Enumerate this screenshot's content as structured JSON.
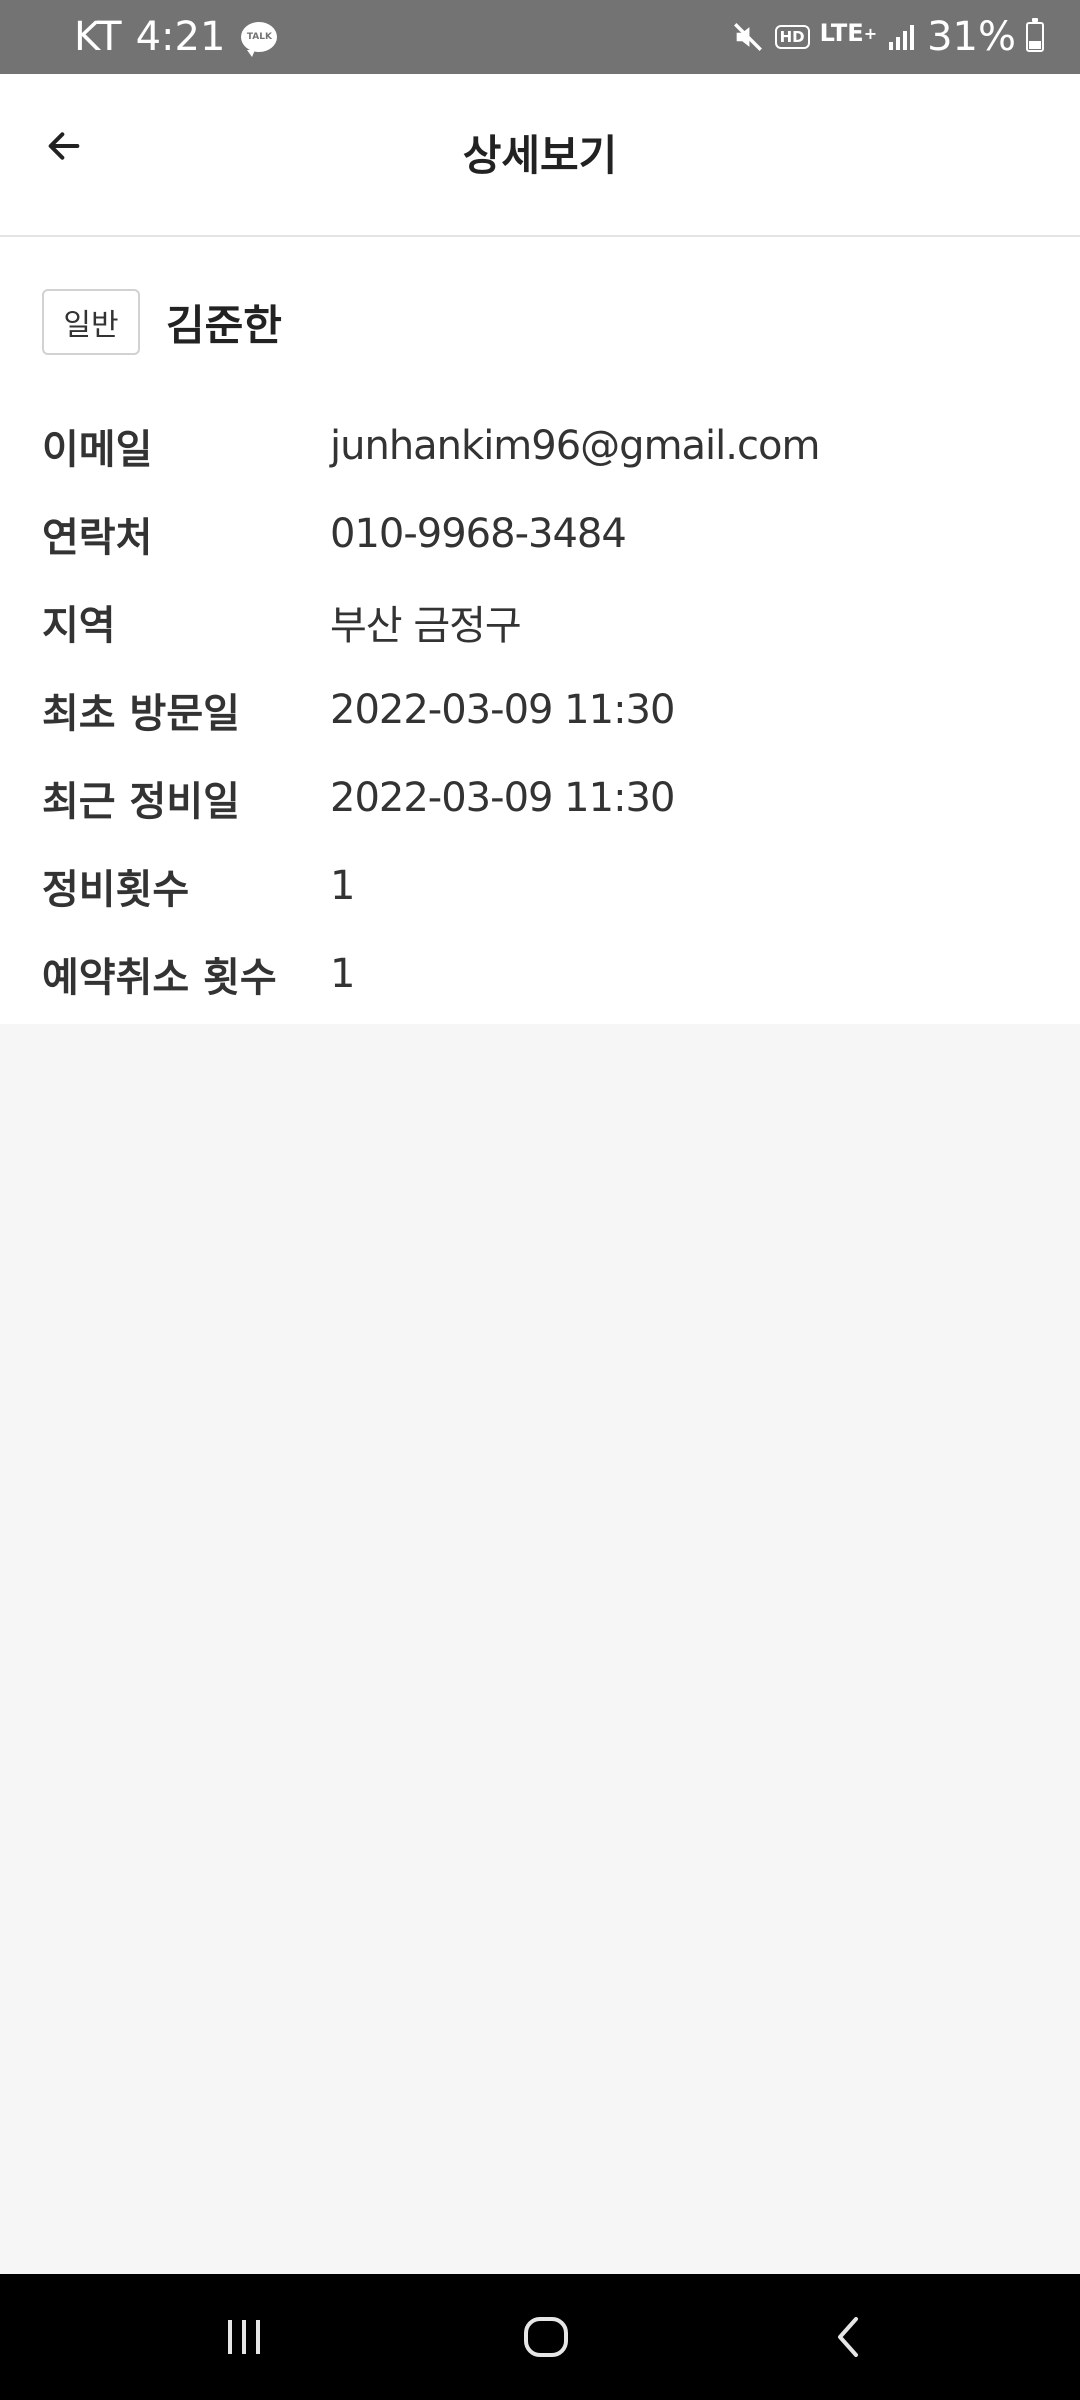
{
  "status_bar": {
    "carrier": "KT",
    "time": "4:21",
    "talk_icon_text": "TALK",
    "hd_label": "HD",
    "network": "LTE",
    "battery": "31%",
    "battery_level": 0.31,
    "icons": [
      "kakaotalk-notification-icon",
      "mute-icon",
      "hd-voice-icon",
      "lte-icon",
      "signal-icon",
      "battery-icon"
    ]
  },
  "app_bar": {
    "title": "상세보기",
    "back_icon": "arrow-left-icon"
  },
  "customer": {
    "type_badge": "일반",
    "name": "김준한"
  },
  "details": [
    {
      "label": "이메일",
      "value": "junhankim96@gmail.com"
    },
    {
      "label": "연락처",
      "value": "010-9968-3484"
    },
    {
      "label": "지역",
      "value": "부산 금정구"
    },
    {
      "label": "최초 방문일",
      "value": "2022-03-09 11:30"
    },
    {
      "label": "최근 정비일",
      "value": "2022-03-09 11:30"
    },
    {
      "label": "정비횟수",
      "value": "1"
    },
    {
      "label": "예약취소 횟수",
      "value": "1"
    }
  ],
  "nav_bar": {
    "icons": [
      "recent-apps-icon",
      "home-icon",
      "back-icon"
    ]
  },
  "colors": {
    "status_bar_bg": "#737373",
    "page_bg": "#f6f6f6",
    "card_bg": "#ffffff",
    "nav_bar_bg": "#000000"
  }
}
